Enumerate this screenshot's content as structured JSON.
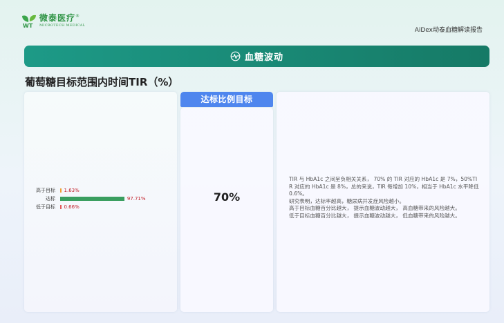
{
  "brand": {
    "name_cn": "微泰医疗",
    "name_en": "MICROTECH MEDICAL",
    "reg_mark": "®",
    "mark_text": "WT",
    "color": "#2f9445"
  },
  "header": {
    "report_title": "AiDex动泰血糖解读报告"
  },
  "banner": {
    "title": "血糖波动",
    "icon": "pulse-chart-icon",
    "color": "#1d9a87"
  },
  "section": {
    "title": "葡萄糖目标范围内时间TIR（%）"
  },
  "chart_data": {
    "type": "bar",
    "orientation": "horizontal",
    "categories": [
      "高于目标",
      "达标",
      "低于目标"
    ],
    "values": [
      1.63,
      97.71,
      0.66
    ],
    "value_labels": [
      "1.63%",
      "97.71%",
      "0.66%"
    ],
    "colors": [
      "#f0a035",
      "#3a9e5f",
      "#e35a5a"
    ],
    "value_label_color": "#c2202a",
    "xlim": [
      0,
      100
    ]
  },
  "target": {
    "header": "达标比例目标",
    "value": "70%",
    "header_color": "#4f86ee"
  },
  "notes": {
    "lines": [
      "TIR 与 HbA1c 之间呈负相关关系， 70% 的 TIR 对应的 HbA1c 是 7%，50%TIR 对应的 HbA1c 是 8%，总的来说，TIR 每增加 10%，相当于 HbA1c 水平降低 0.6%。",
      "研究表明，达标率越高，糖尿病并发症风险越小。",
      "高于目标血糖百分比越大， 提示血糖波动越大， 高血糖带来的风险越大。",
      "低于目标血糖百分比越大， 提示血糖波动越大， 低血糖带来的风险越大。"
    ]
  }
}
